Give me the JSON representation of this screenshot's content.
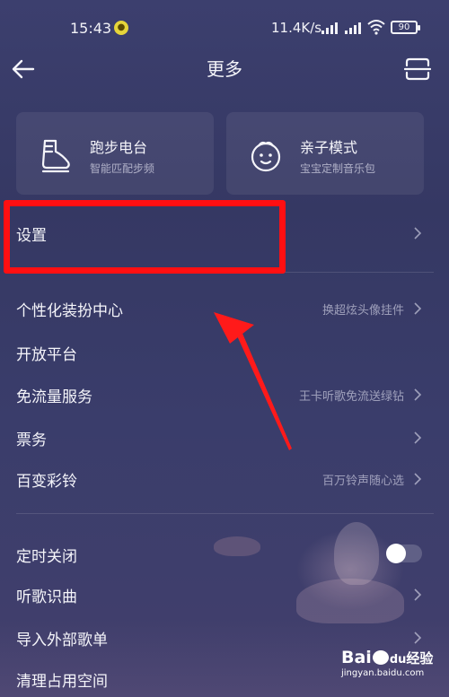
{
  "status_bar": {
    "time": "15:43",
    "network_speed": "11.4K/s",
    "battery": "90",
    "app_icon": "notification-app-icon"
  },
  "header": {
    "title": "更多",
    "back_icon": "arrow-left-icon",
    "scan_icon": "scan-icon"
  },
  "cards": [
    {
      "title": "跑步电台",
      "subtitle": "智能匹配步频",
      "icon": "running-shoe-icon"
    },
    {
      "title": "亲子模式",
      "subtitle": "宝宝定制音乐包",
      "icon": "baby-face-icon"
    }
  ],
  "settings_row": {
    "label": "设置"
  },
  "menu_group_1": [
    {
      "label": "个性化装扮中心",
      "value": "换超炫头像挂件"
    },
    {
      "label": "开放平台",
      "value": ""
    },
    {
      "label": "免流量服务",
      "value": "王卡听歌免流送绿钻"
    },
    {
      "label": "票务",
      "value": ""
    },
    {
      "label": "百变彩铃",
      "value": "百万铃声随心选"
    }
  ],
  "menu_group_2": [
    {
      "label": "定时关闭",
      "control": "toggle",
      "toggle_on": false
    },
    {
      "label": "听歌识曲",
      "control": "chevron"
    },
    {
      "label": "导入外部歌单",
      "control": "chevron"
    },
    {
      "label": "清理占用空间",
      "control": "none"
    }
  ],
  "annotation": {
    "box_color": "#ff0f12",
    "arrow_color": "#ff1a1a"
  },
  "watermark": {
    "logo_left": "Bai",
    "logo_mid": "du",
    "logo_right": "经验",
    "url": "jingyan.baidu.com"
  },
  "colors": {
    "background": "#373a66",
    "text": "#f5f5fa",
    "secondary_text": "#a9a9c4"
  }
}
